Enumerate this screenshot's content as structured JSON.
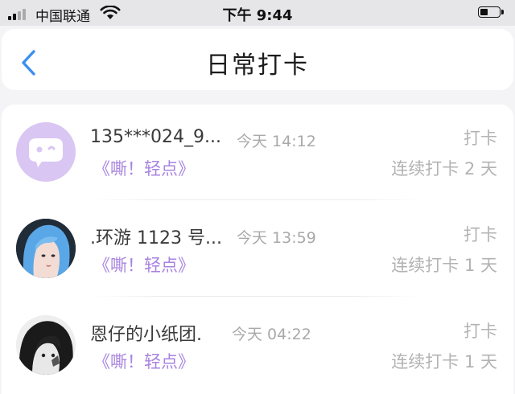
{
  "status_bar": {
    "carrier": "中国联通",
    "time": "下午 9:44"
  },
  "nav": {
    "title": "日常打卡",
    "back_icon": "chevron-left-icon"
  },
  "colors": {
    "accent_link": "#a883e0",
    "avatar_bg": "#d9c6f3",
    "muted": "#b3b3b3",
    "back": "#3b8ff0"
  },
  "records": [
    {
      "name": "135***024_9...",
      "date": "今天 14:12",
      "link": "《嘶！轻点》",
      "checkin": "打卡",
      "streak": "连续打卡 2 天",
      "avatar_icon": "chat-bubble-icon"
    },
    {
      "name": ".环游 1123 号...",
      "date": "今天 13:59",
      "link": "《嘶！轻点》",
      "checkin": "打卡",
      "streak": "连续打卡 1 天",
      "avatar_icon": "blue-hair-portrait"
    },
    {
      "name": "恩仔的小纸团.",
      "date": "今天 04:22",
      "link": "《嘶！轻点》",
      "checkin": "打卡",
      "streak": "连续打卡 1 天",
      "avatar_icon": "monochrome-portrait"
    }
  ]
}
